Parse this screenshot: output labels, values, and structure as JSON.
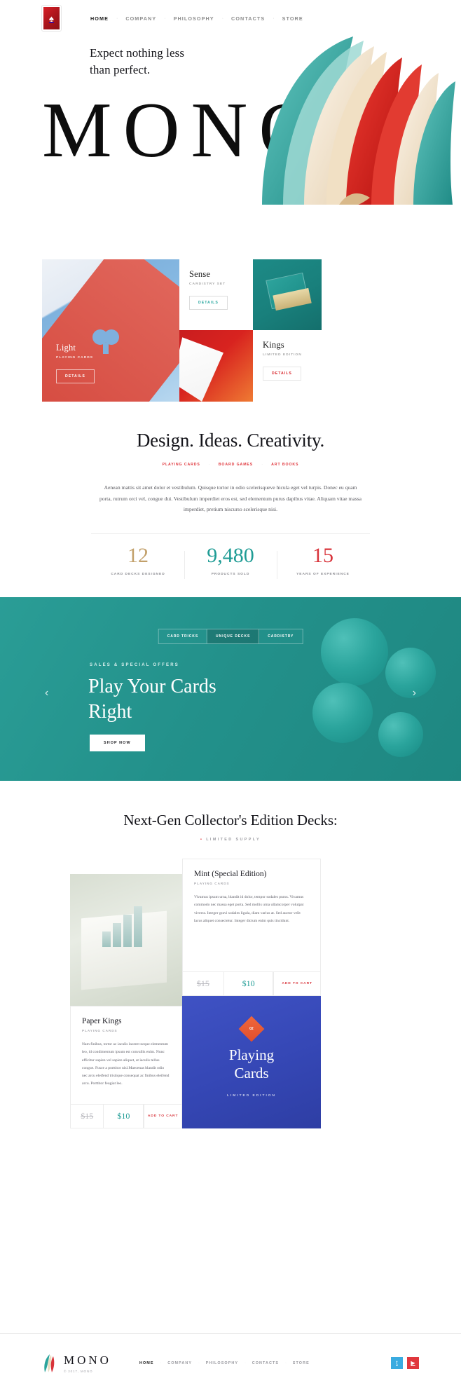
{
  "header": {
    "logo_icon": "spade-card-icon",
    "nav": [
      {
        "label": "HOME",
        "active": true
      },
      {
        "label": "COMPANY",
        "active": false
      },
      {
        "label": "PHILOSOPHY",
        "active": false
      },
      {
        "label": "CONTACTS",
        "active": false
      },
      {
        "label": "STORE",
        "active": false
      }
    ]
  },
  "hero": {
    "subtitle_line1": "Expect nothing less",
    "subtitle_line2": "than perfect.",
    "wordmark": "MONO",
    "art_icon": "spade-3d-illustration"
  },
  "grid": {
    "light": {
      "title": "Light",
      "subtitle": "PLAYING CARDS",
      "button": "DETAILS"
    },
    "sense": {
      "title": "Sense",
      "subtitle": "CARDISTRY SET",
      "button": "DETAILS"
    },
    "kings": {
      "title": "Kings",
      "subtitle": "LIMITED EDITION",
      "button": "DETAILS"
    }
  },
  "design": {
    "heading": "Design. Ideas. Creativity.",
    "categories": [
      "PLAYING CARDS",
      "BOARD GAMES",
      "ART BOOKS"
    ],
    "paragraph": "Aenean mattis sit amet dolor et vestibulum. Quisque tortor in odio scelerisqueve hicula eget vel turpis. Donec eu quam porta, rutrum orci vel, congue dui. Vestibulum imperdiet eros est, sed elementum purus dapibus vitae. Aliquam vitae massa imperdiet, pretium niscurso scelerisque nisi."
  },
  "stats": [
    {
      "value": "12",
      "label": "CARD DECKS DESIGNED",
      "color": "#c2a06a"
    },
    {
      "value": "9,480",
      "label": "PRODUCTS SOLD",
      "color": "#1f9c95"
    },
    {
      "value": "15",
      "label": "YEARS OF EXPERIENCE",
      "color": "#d8333a"
    }
  ],
  "slider": {
    "tabs": [
      {
        "label": "CARD TRICKS",
        "active": false
      },
      {
        "label": "UNIQUE DECKS",
        "active": true
      },
      {
        "label": "CARDISTRY",
        "active": false
      }
    ],
    "kicker": "SALES & SPECIAL OFFERS",
    "title_line1": "Play Your Cards",
    "title_line2": "Right",
    "button": "SHOP NOW",
    "prev_icon": "chevron-left-icon",
    "next_icon": "chevron-right-icon",
    "background_color": "#23918b"
  },
  "nextgen": {
    "heading": "Next-Gen Collector's Edition Decks:",
    "supply_label": "LIMITED SUPPLY",
    "photo_icon": "deck-box-photo"
  },
  "products": [
    {
      "title": "Mint (Special Edition)",
      "subtitle": "PLAYING CARDS",
      "text": "Vivamus ipsum urna, blandit id dolor, tempor sodales purus. Vivamus commodo nec massa eget porta. Sed mollis urna ullamcorper volutpat viverra. Integer gravi sodales ligula, diam varius at.\n\nSed auctor velit lacus aliquet consectetur. Integer dictum enim quis tincidunt.",
      "price_old": "$15",
      "price_new": "$10",
      "cart_label": "ADD TO CART"
    },
    {
      "title": "Paper Kings",
      "subtitle": "PLAYING CARDS",
      "text": "Nam finibus, tortor ac iaculis laoreet neque elementum leo, id condimentum ipsum est convallis enim. Nunc efficitur sapien vel sapien aliquet, at iaculis tellus congue. Fusce a porttitor nisl.Maecenas blandit odio nec arcu eleifend tristique consequat ac finibus eleifend arcu. Porttitor feugiat leo.",
      "price_old": "$15",
      "price_new": "$10",
      "cart_label": "ADD TO CART"
    }
  ],
  "blue_card": {
    "badge": "02",
    "title_line1": "Playing",
    "title_line2": "Cards",
    "subtitle": "LIMITED EDITION"
  },
  "footer": {
    "logo_icon": "feather-icon",
    "brand": "MONO",
    "copyright": "© 2017, MONO",
    "nav": [
      {
        "label": "HOME",
        "active": true
      },
      {
        "label": "COMPANY",
        "active": false
      },
      {
        "label": "PHILOSOPHY",
        "active": false
      },
      {
        "label": "CONTACTS",
        "active": false
      },
      {
        "label": "STORE",
        "active": false
      }
    ],
    "socials": [
      {
        "name": "twitter-icon",
        "glyph": "t",
        "color": "#3aabe0"
      },
      {
        "name": "youtube-icon",
        "glyph": "▶",
        "color": "#e0373d"
      }
    ]
  }
}
